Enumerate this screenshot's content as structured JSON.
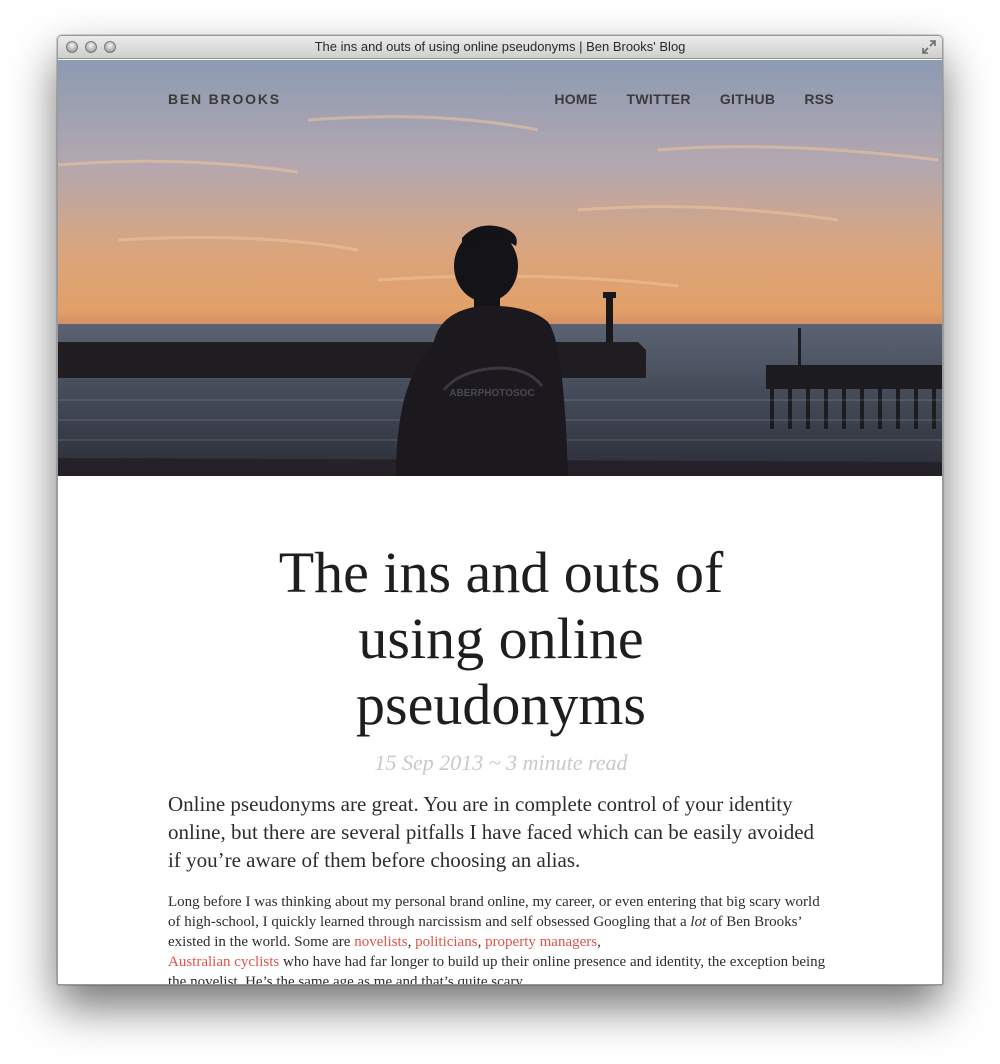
{
  "window": {
    "title": "The ins and outs of using online pseudonyms | Ben Brooks' Blog"
  },
  "site": {
    "brand": "BEN BROOKS",
    "nav": [
      {
        "label": "HOME"
      },
      {
        "label": "TWITTER"
      },
      {
        "label": "GITHUB"
      },
      {
        "label": "RSS"
      }
    ]
  },
  "hero": {
    "hoodie_text": "ABERPHOTOSOC"
  },
  "post": {
    "title": "The ins and outs of using online pseudonyms",
    "meta": "15 Sep 2013 ~ 3 minute read",
    "lead": "Online pseudonyms are great. You are in complete control of your identity online, but there are several pitfalls I have faced which can be easily avoided if you’re aware of them before choosing an alias.",
    "para": {
      "t1": "Long before I was thinking about my personal brand online, my career, or even entering that big scary world of high-school, I quickly learned through narcissism and self obsessed Googling that a ",
      "em": "lot",
      "t2": " of Ben Brooks’ existed in the world. Some are ",
      "link1": "novelists",
      "sep1": ", ",
      "link2": "politicians",
      "sep2": ", ",
      "link3": "property managers",
      "sep3": ",",
      "link4": "Australian cyclists",
      "t3": " who have had far longer to build up their online presence and identity, the exception being the novelist. He’s the same age as me and that’s quite scary."
    }
  },
  "colors": {
    "link": "#e0534a",
    "meta": "#c9c9c9",
    "text": "#2d2d2d"
  }
}
